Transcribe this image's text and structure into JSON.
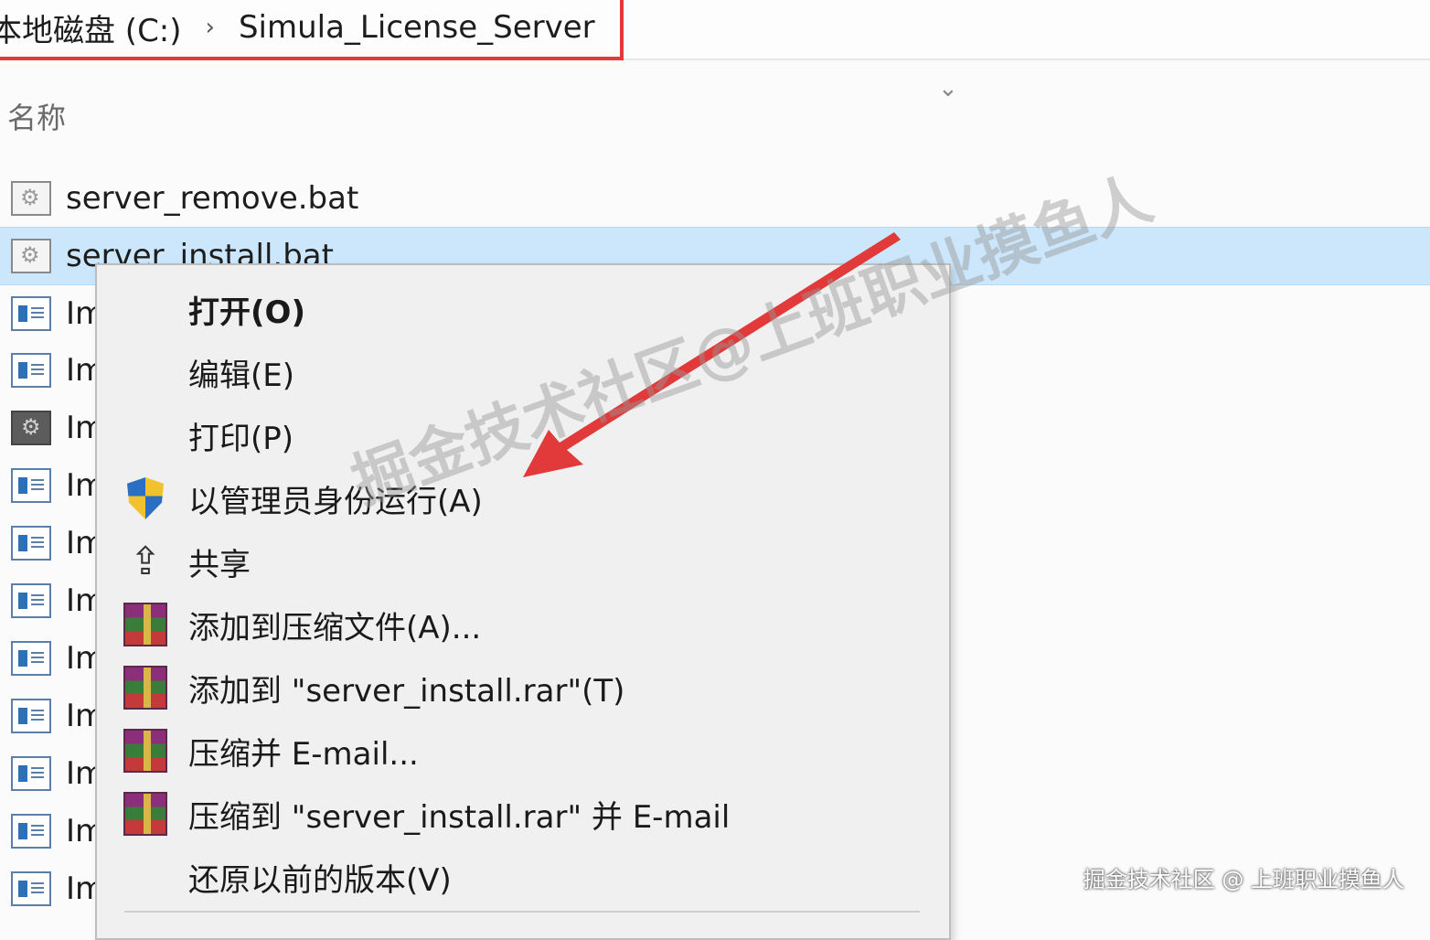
{
  "address_bar": {
    "segments": [
      "本地磁盘 (C:)",
      "Simula_License_Server"
    ],
    "separator": "›",
    "highlight_color": "#e23a3a"
  },
  "list_header": {
    "name_label": "名称",
    "sort_icon": "chevron-down-icon"
  },
  "files": [
    {
      "name": "server_remove.bat",
      "icon": "bat-file-icon",
      "selected": false
    },
    {
      "name": "server_install.bat",
      "icon": "bat-file-icon",
      "selected": true
    },
    {
      "name": "Im",
      "icon": "doc-file-icon"
    },
    {
      "name": "Im",
      "icon": "doc-file-icon"
    },
    {
      "name": "Im",
      "icon": "exe-file-icon"
    },
    {
      "name": "Im",
      "icon": "doc-file-icon"
    },
    {
      "name": "Im",
      "icon": "doc-file-icon"
    },
    {
      "name": "Im",
      "icon": "doc-file-icon"
    },
    {
      "name": "Im",
      "icon": "doc-file-icon"
    },
    {
      "name": "Im",
      "icon": "doc-file-icon"
    },
    {
      "name": "Im",
      "icon": "doc-file-icon"
    },
    {
      "name": "Im",
      "icon": "doc-file-icon"
    },
    {
      "name": "Im",
      "icon": "doc-file-icon"
    }
  ],
  "context_menu": {
    "items": [
      {
        "label": "打开(O)",
        "icon": "",
        "bold": true
      },
      {
        "label": "编辑(E)",
        "icon": ""
      },
      {
        "label": "打印(P)",
        "icon": ""
      },
      {
        "label": "以管理员身份运行(A)",
        "icon": "uac-shield-icon"
      },
      {
        "label": "共享",
        "icon": "share-icon"
      },
      {
        "label": "添加到压缩文件(A)...",
        "icon": "winrar-icon"
      },
      {
        "label": "添加到 \"server_install.rar\"(T)",
        "icon": "winrar-icon"
      },
      {
        "label": "压缩并 E-mail...",
        "icon": "winrar-icon"
      },
      {
        "label": "压缩到 \"server_install.rar\" 并 E-mail",
        "icon": "winrar-icon"
      },
      {
        "label": "还原以前的版本(V)",
        "icon": ""
      }
    ]
  },
  "watermark": {
    "main": "掘金技术社区@上班职业摸鱼人",
    "corner": "掘金技术社区 @ 上班职业摸鱼人"
  },
  "annotation_arrow_color": "#e23a3a"
}
